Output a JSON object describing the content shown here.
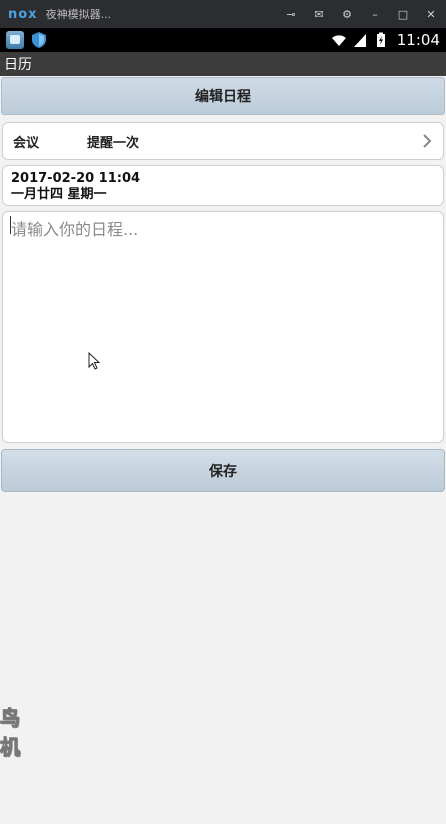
{
  "emulator": {
    "logo": "nox",
    "title": "夜神模拟器...",
    "controls": [
      "pin-icon",
      "mail-icon",
      "gear-icon",
      "minimize-icon",
      "maximize-icon",
      "close-icon"
    ]
  },
  "status_bar": {
    "icons_left": [
      "app-icon",
      "shield-icon"
    ],
    "icons_right": [
      "wifi-icon",
      "signal-icon",
      "battery-icon"
    ],
    "time": "11:04"
  },
  "app": {
    "title": "日历"
  },
  "header": {
    "title": "编辑日程"
  },
  "reminder": {
    "type": "会议",
    "repeat": "提醒一次"
  },
  "date": {
    "datetime": "2017-02-20 11:04",
    "lunar": "一月廿四 星期一"
  },
  "schedule_input": {
    "placeholder": "请输入你的日程...",
    "value": ""
  },
  "save": {
    "label": "保存"
  },
  "watermark": {
    "lines": [
      "鸟",
      "机"
    ]
  },
  "colors": {
    "header_gradient_top": "#cfdbe6",
    "header_gradient_bottom": "#bcccd9",
    "app_title_bg": "#3c3c3c",
    "page_bg": "#f2f2f2"
  }
}
